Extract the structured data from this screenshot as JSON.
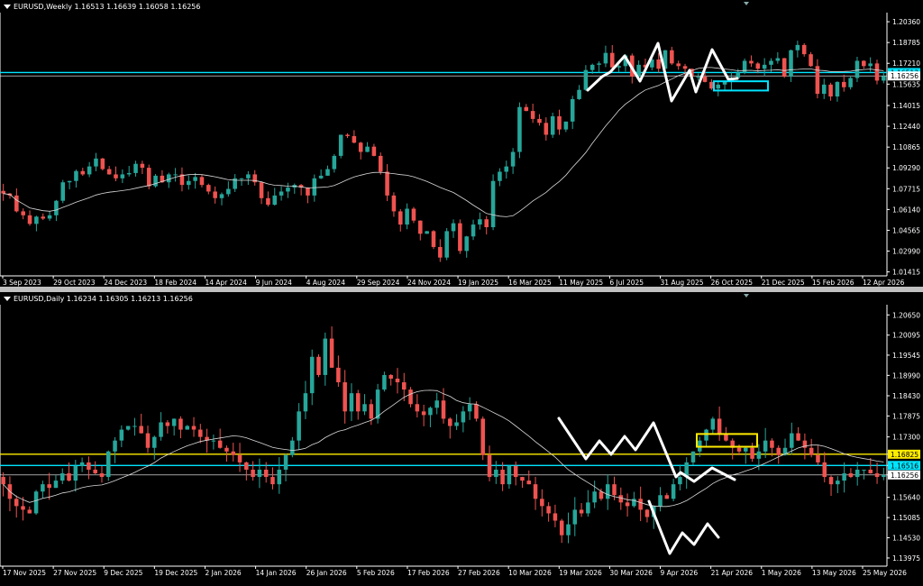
{
  "colors": {
    "bull": "#26a69a",
    "bear": "#ef5350",
    "ma": "#d9d9d9",
    "axis": "#ffffff",
    "cyan": "#00e5ff",
    "yellow": "#ffeb00",
    "annot": "#ffffff"
  },
  "chart_data": [
    {
      "type": "candlestick",
      "title": "EURUSD,Weekly  1.16513 1.16639 1.16058 1.16256",
      "x_ticks": [
        "3 Sep 2023",
        "29 Oct 2023",
        "24 Dec 2023",
        "18 Feb 2024",
        "14 Apr 2024",
        "9 Jun 2024",
        "4 Aug 2024",
        "29 Sep 2024",
        "24 Nov 2024",
        "19 Jan 2025",
        "16 Mar 2025",
        "11 May 2025",
        "6 Jul 2025",
        "31 Aug 2025",
        "26 Oct 2025",
        "21 Dec 2025",
        "15 Feb 2026",
        "12 Apr 2026"
      ],
      "y_ticks": [
        1.2036,
        1.18785,
        1.1721,
        1.15635,
        1.14015,
        1.1244,
        1.10865,
        1.0929,
        1.07715,
        1.0614,
        1.04565,
        1.0299,
        1.01415
      ],
      "ylim": [
        1.0125,
        1.2105
      ],
      "price_labels": [
        {
          "text": "1.16513",
          "value": 1.16513,
          "color": "cyan"
        },
        {
          "text": "1.16256",
          "value": 1.16256,
          "color": "white"
        }
      ],
      "hlines": [
        {
          "value": 1.16513,
          "color": "cyan"
        },
        {
          "value": 1.16256,
          "color": "white"
        }
      ],
      "close": [
        1.0735,
        1.072,
        1.06,
        1.057,
        1.0505,
        1.056,
        1.0545,
        1.057,
        1.068,
        1.082,
        1.083,
        1.0905,
        1.088,
        1.094,
        1.1,
        1.092,
        1.088,
        1.085,
        1.088,
        1.089,
        1.096,
        1.093,
        1.079,
        1.087,
        1.082,
        1.088,
        1.088,
        1.08,
        1.083,
        1.086,
        1.08,
        1.075,
        1.07,
        1.073,
        1.077,
        1.085,
        1.085,
        1.088,
        1.082,
        1.07,
        1.065,
        1.072,
        1.075,
        1.078,
        1.08,
        1.078,
        1.072,
        1.085,
        1.087,
        1.092,
        1.102,
        1.118,
        1.117,
        1.112,
        1.105,
        1.109,
        1.102,
        1.09,
        1.072,
        1.06,
        1.05,
        1.062,
        1.053,
        1.043,
        1.045,
        1.033,
        1.025,
        1.045,
        1.051,
        1.03,
        1.041,
        1.05,
        1.054,
        1.048,
        1.083,
        1.09,
        1.094,
        1.105,
        1.139,
        1.136,
        1.13,
        1.127,
        1.118,
        1.132,
        1.122,
        1.128,
        1.145,
        1.152,
        1.167,
        1.171,
        1.172,
        1.18,
        1.169,
        1.17,
        1.178,
        1.162,
        1.171,
        1.169,
        1.175,
        1.168,
        1.182,
        1.172,
        1.17,
        1.168,
        1.162,
        1.162,
        1.158,
        1.153,
        1.156,
        1.158,
        1.161,
        1.165,
        1.174,
        1.172,
        1.168,
        1.171,
        1.174,
        1.176,
        1.162,
        1.182,
        1.186,
        1.179,
        1.17,
        1.149,
        1.156,
        1.147,
        1.158,
        1.154,
        1.161,
        1.174,
        1.17,
        1.172,
        1.159,
        1.1625
      ],
      "series": [
        {
          "name": "",
          "type": "moving-average"
        }
      ],
      "annotations": [
        {
          "type": "zigzag",
          "color": "white"
        },
        {
          "type": "rectangle",
          "color": "cyan",
          "y": [
            1.1515,
            1.1585
          ]
        }
      ]
    },
    {
      "type": "candlestick",
      "title": "EURUSD,Daily  1.16234 1.16305 1.16213 1.16256",
      "x_ticks": [
        "17 Nov 2025",
        "27 Nov 2025",
        "9 Dec 2025",
        "19 Dec 2025",
        "2 Jan 2026",
        "14 Jan 2026",
        "26 Jan 2026",
        "5 Feb 2026",
        "17 Feb 2026",
        "27 Feb 2026",
        "10 Mar 2026",
        "19 Mar 2026",
        "30 Mar 2026",
        "9 Apr 2026",
        "21 Apr 2026",
        "1 May 2026",
        "13 May 2026",
        "25 May 2026"
      ],
      "y_ticks": [
        1.2065,
        1.20095,
        1.19545,
        1.1899,
        1.1843,
        1.17875,
        1.173,
        1.16825,
        1.16516,
        1.16256,
        1.1564,
        1.15085,
        1.1453,
        1.13975
      ],
      "ylim": [
        1.138,
        1.2093
      ],
      "price_labels": [
        {
          "text": "1.16825",
          "value": 1.16825,
          "color": "yellow"
        },
        {
          "text": "1.16516",
          "value": 1.16516,
          "color": "cyan"
        },
        {
          "text": "1.16256",
          "value": 1.16256,
          "color": "white"
        }
      ],
      "hlines": [
        {
          "value": 1.16825,
          "color": "yellow"
        },
        {
          "value": 1.16516,
          "color": "cyan"
        },
        {
          "value": 1.16256,
          "color": "white"
        }
      ],
      "close": [
        1.16,
        1.156,
        1.154,
        1.153,
        1.152,
        1.158,
        1.16,
        1.159,
        1.161,
        1.163,
        1.161,
        1.165,
        1.166,
        1.164,
        1.163,
        1.162,
        1.169,
        1.172,
        1.175,
        1.176,
        1.176,
        1.174,
        1.17,
        1.173,
        1.177,
        1.176,
        1.178,
        1.175,
        1.176,
        1.175,
        1.173,
        1.172,
        1.172,
        1.17,
        1.169,
        1.168,
        1.166,
        1.164,
        1.162,
        1.164,
        1.162,
        1.16,
        1.164,
        1.168,
        1.172,
        1.18,
        1.185,
        1.195,
        1.19,
        1.2,
        1.192,
        1.188,
        1.18,
        1.185,
        1.18,
        1.182,
        1.178,
        1.186,
        1.19,
        1.189,
        1.188,
        1.186,
        1.182,
        1.18,
        1.179,
        1.181,
        1.183,
        1.178,
        1.176,
        1.177,
        1.18,
        1.182,
        1.178,
        1.168,
        1.162,
        1.164,
        1.16,
        1.165,
        1.162,
        1.161,
        1.16,
        1.156,
        1.154,
        1.152,
        1.15,
        1.146,
        1.149,
        1.153,
        1.152,
        1.155,
        1.158,
        1.156,
        1.16,
        1.157,
        1.155,
        1.154,
        1.156,
        1.153,
        1.151,
        1.154,
        1.157,
        1.156,
        1.16,
        1.162,
        1.166,
        1.169,
        1.172,
        1.175,
        1.178,
        1.174,
        1.172,
        1.17,
        1.169,
        1.17,
        1.167,
        1.169,
        1.172,
        1.17,
        1.168,
        1.17,
        1.174,
        1.172,
        1.17,
        1.168,
        1.166,
        1.162,
        1.16,
        1.161,
        1.163,
        1.162,
        1.164,
        1.164,
        1.163,
        1.162,
        1.1625
      ],
      "series": [
        {
          "name": "",
          "type": "moving-average"
        }
      ],
      "annotations": [
        {
          "type": "zigzag",
          "color": "white"
        },
        {
          "type": "zigzag",
          "color": "white"
        },
        {
          "type": "rectangle",
          "color": "yellow",
          "y": [
            1.1703,
            1.1738
          ]
        }
      ]
    }
  ]
}
